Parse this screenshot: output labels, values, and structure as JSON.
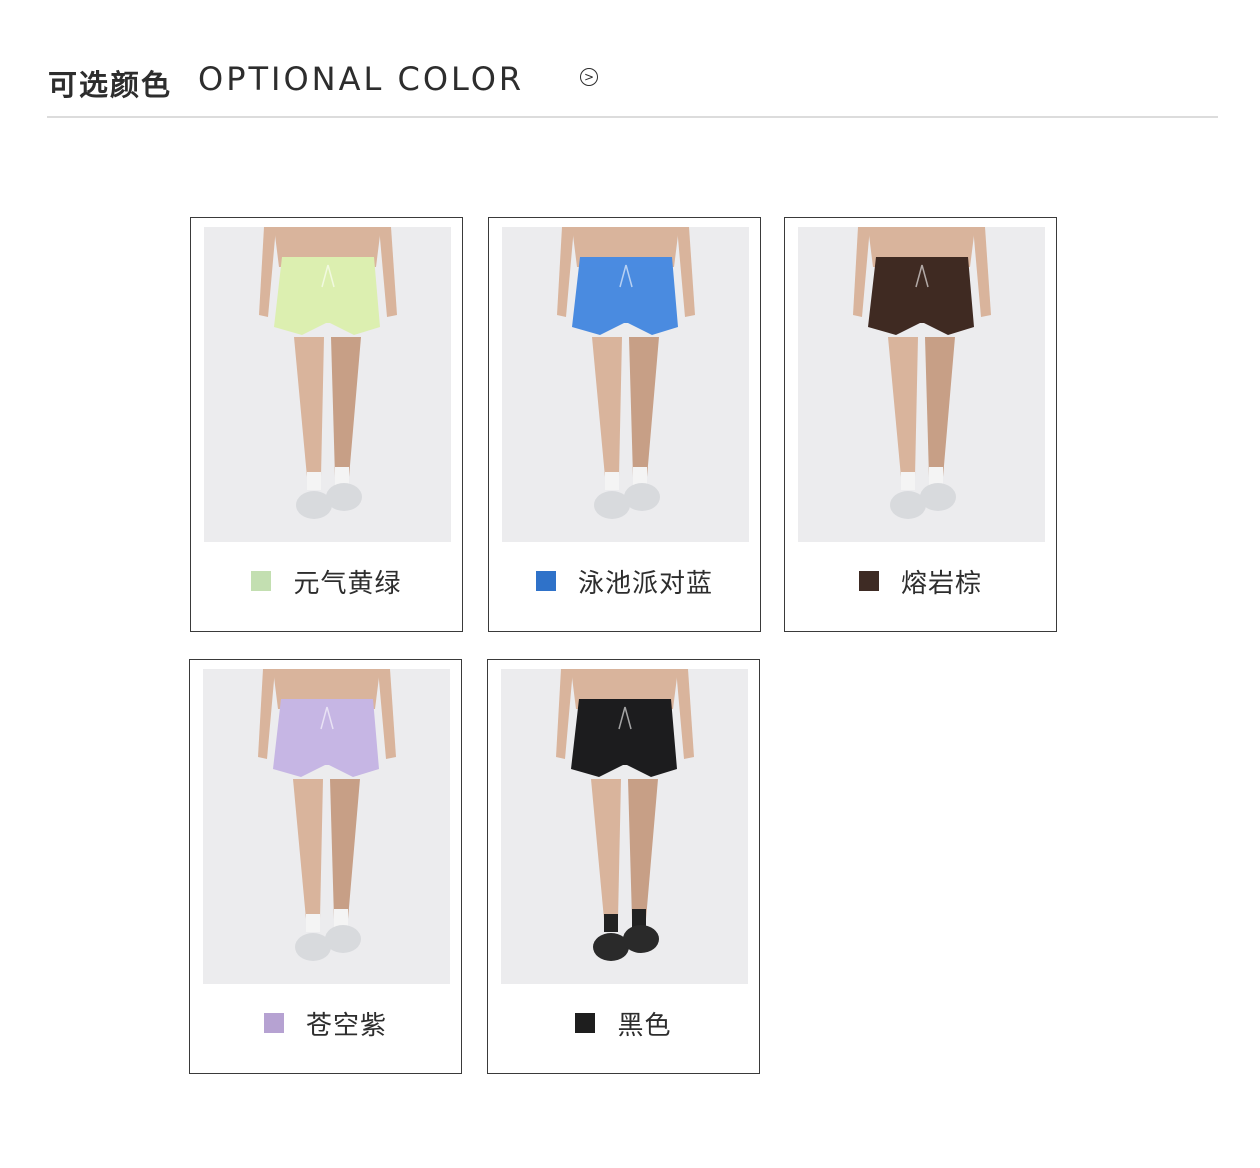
{
  "header": {
    "title_cn": "可选颜色",
    "title_en": "OPTIONAL COLOR",
    "icon": "circle-arrow-right-icon"
  },
  "colors": [
    {
      "label": "元气黄绿",
      "swatch": "#c3dfb1",
      "shorts": "#dcefb0"
    },
    {
      "label": "泳池派对蓝",
      "swatch": "#2f72c9",
      "shorts": "#4a8be0"
    },
    {
      "label": "熔岩棕",
      "swatch": "#3e2b24",
      "shorts": "#3f2a22"
    },
    {
      "label": "苍空紫",
      "swatch": "#b6a2d2",
      "shorts": "#c6b6e4"
    },
    {
      "label": "黑色",
      "swatch": "#1e1e1e",
      "shorts": "#1c1c1e"
    }
  ]
}
